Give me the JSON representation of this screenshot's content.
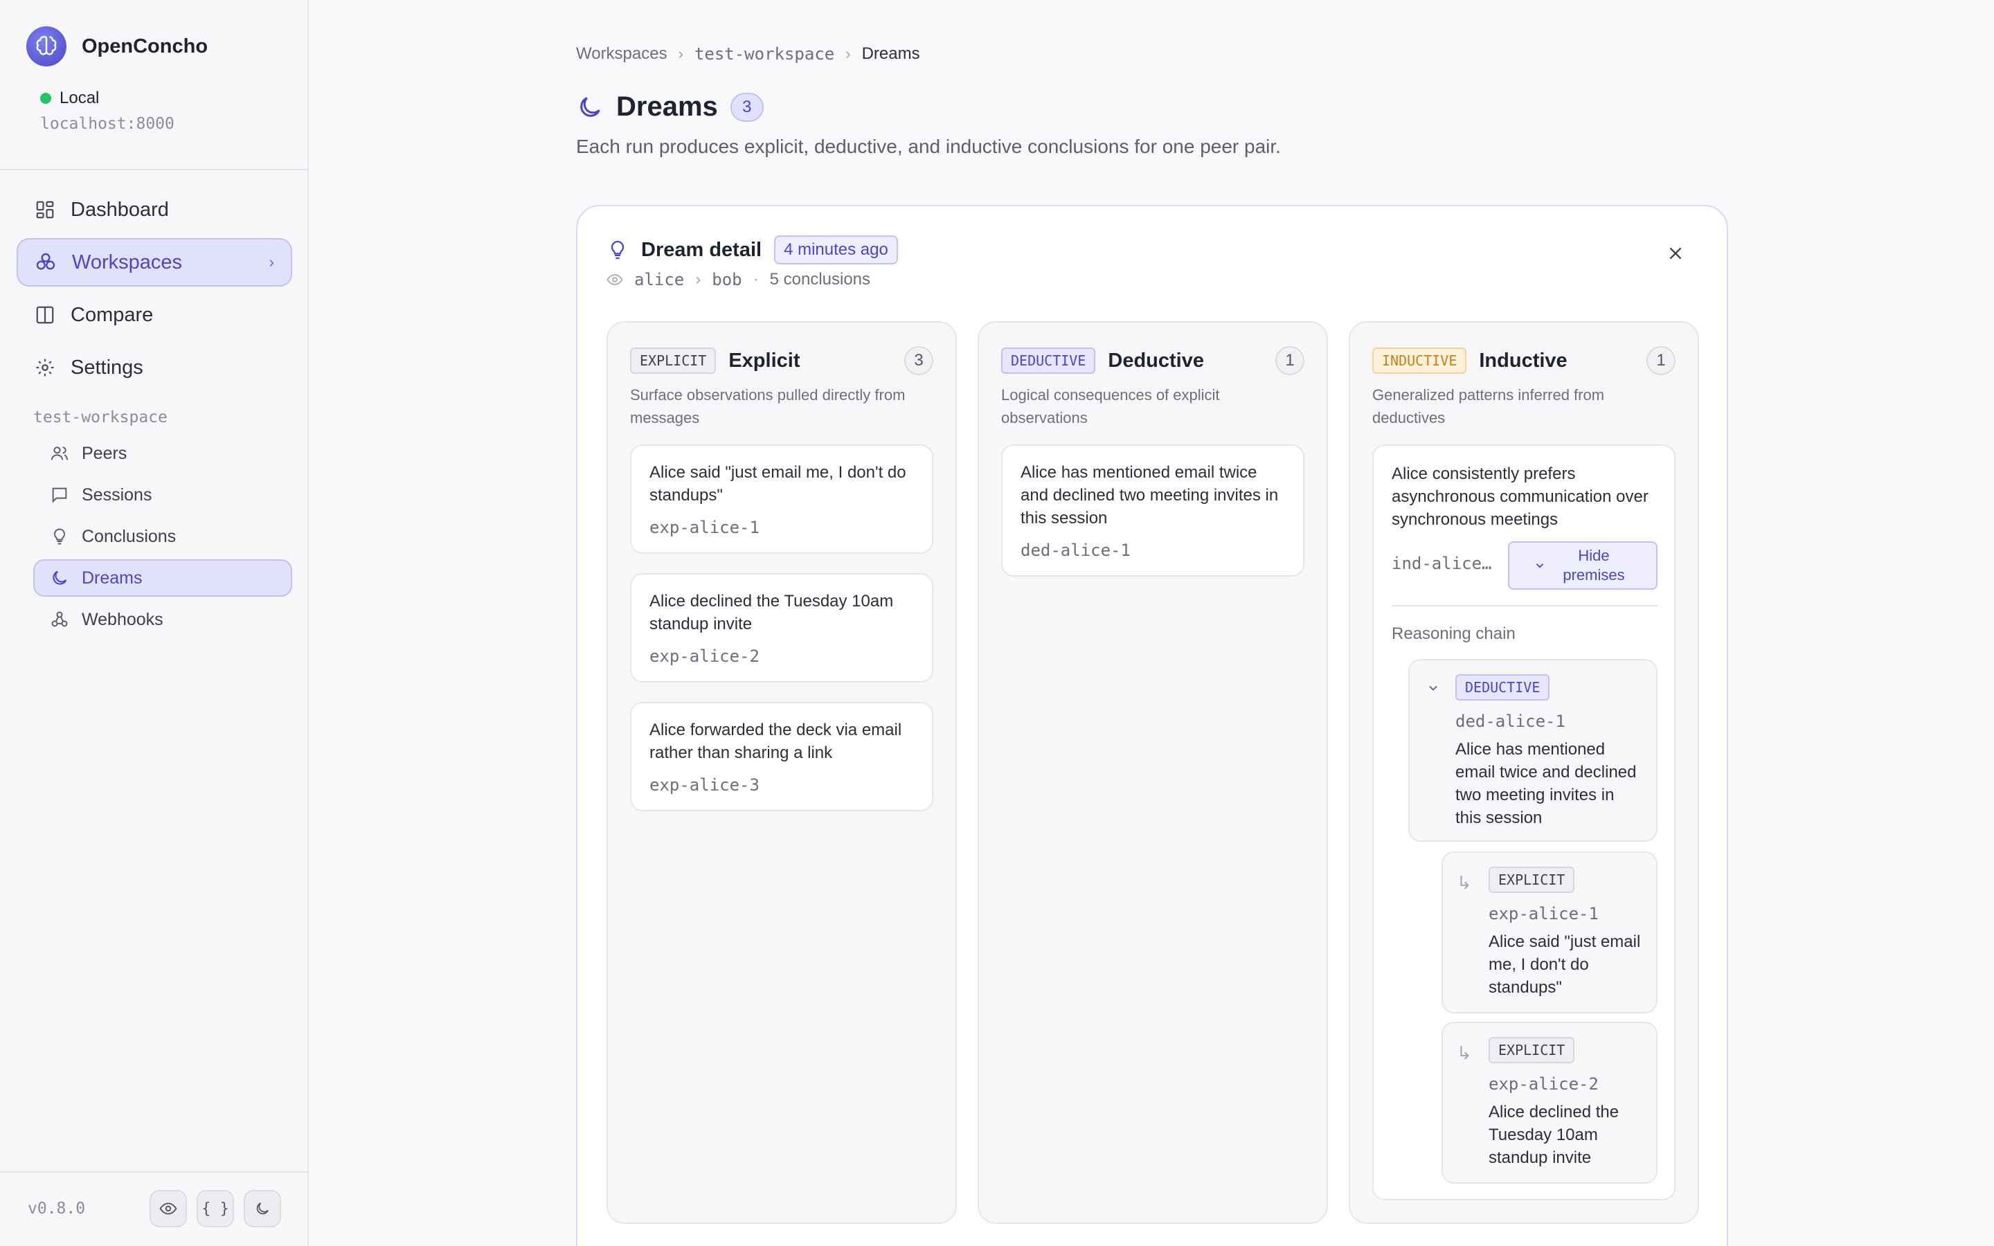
{
  "app": {
    "name": "OpenConcho"
  },
  "environment": {
    "name": "Local",
    "host": "localhost:8000"
  },
  "nav": {
    "items": [
      {
        "label": "Dashboard"
      },
      {
        "label": "Workspaces"
      },
      {
        "label": "Compare"
      },
      {
        "label": "Settings"
      }
    ]
  },
  "workspace": {
    "name": "test-workspace",
    "items": [
      {
        "label": "Peers"
      },
      {
        "label": "Sessions"
      },
      {
        "label": "Conclusions"
      },
      {
        "label": "Dreams"
      },
      {
        "label": "Webhooks"
      }
    ]
  },
  "footer": {
    "version": "v0.8.0",
    "code_label": "{ }"
  },
  "breadcrumb": [
    "Workspaces",
    "test-workspace",
    "Dreams"
  ],
  "page": {
    "title": "Dreams",
    "count": "3",
    "subtitle": "Each run produces explicit, deductive, and inductive conclusions for one peer pair."
  },
  "detail": {
    "title": "Dream detail",
    "time": "4 minutes ago",
    "observer": "alice",
    "observed": "bob",
    "dot": "·",
    "conclusions": "5 conclusions",
    "columns": [
      {
        "tag": "EXPLICIT",
        "title": "Explicit",
        "count": "3",
        "description": "Surface observations pulled directly from messages",
        "cards": [
          {
            "text": "Alice said \"just email me, I don't do standups\"",
            "id": "exp-alice-1"
          },
          {
            "text": "Alice declined the Tuesday 10am standup invite",
            "id": "exp-alice-2"
          },
          {
            "text": "Alice forwarded the deck via email rather than sharing a link",
            "id": "exp-alice-3"
          }
        ]
      },
      {
        "tag": "DEDUCTIVE",
        "title": "Deductive",
        "count": "1",
        "description": "Logical consequences of explicit observations",
        "cards": [
          {
            "text": "Alice has mentioned email twice and declined two meeting invites in this session",
            "id": "ded-alice-1"
          }
        ]
      },
      {
        "tag": "INDUCTIVE",
        "title": "Inductive",
        "count": "1",
        "description": "Generalized patterns inferred from deductives",
        "card": {
          "text": "Alice consistently prefers asynchronous communication over synchronous meetings",
          "id": "ind-alice…",
          "toggle_label": "Hide premises",
          "chain_label": "Reasoning chain",
          "chain": [
            {
              "tag": "DEDUCTIVE",
              "id": "ded-alice-1",
              "text": "Alice has mentioned email twice and declined two meeting invites in this session"
            },
            {
              "tag": "EXPLICIT",
              "id": "exp-alice-1",
              "text": "Alice said \"just email me, I don't do standups\""
            },
            {
              "tag": "EXPLICIT",
              "id": "exp-alice-2",
              "text": "Alice declined the Tuesday 10am standup invite"
            }
          ]
        }
      }
    ]
  },
  "colors": {
    "accent": "#4a46c9",
    "accent_bg": "#e2e1fb",
    "status_online": "#22c55e",
    "inductive": "#c2821f"
  }
}
